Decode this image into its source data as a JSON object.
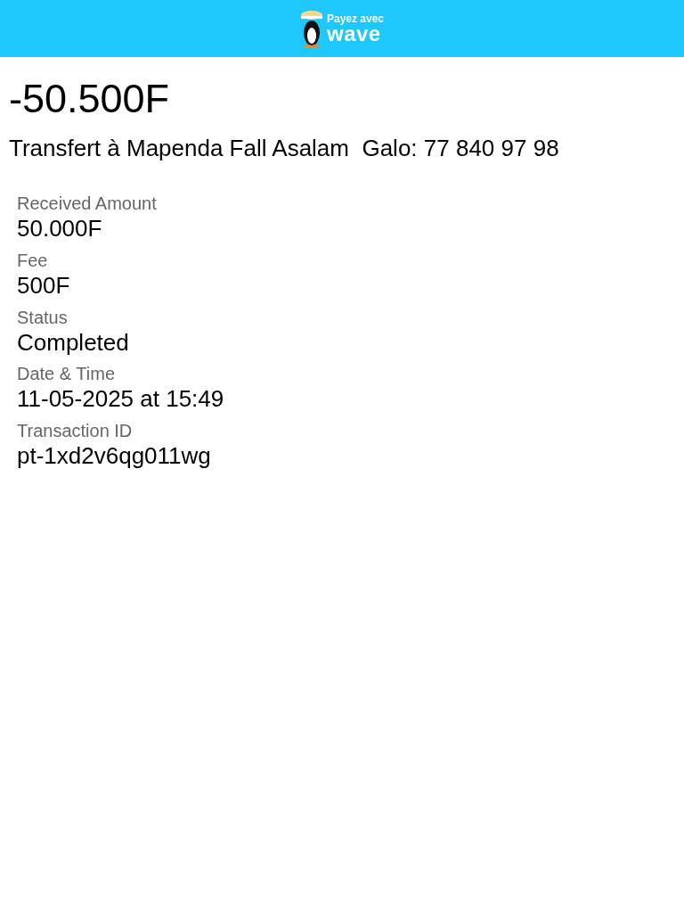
{
  "header": {
    "logo_line1": "Payez avec",
    "logo_line2": "wave"
  },
  "amount": "-50.500F",
  "description": "Transfert à Mapenda Fall Asalam  Galo: 77 840 97 98",
  "details": [
    {
      "label": "Received Amount",
      "value": "50.000F"
    },
    {
      "label": "Fee",
      "value": "500F"
    },
    {
      "label": "Status",
      "value": "Completed"
    },
    {
      "label": "Date & Time",
      "value": "11-05-2025 at 15:49"
    },
    {
      "label": "Transaction ID",
      "value": "pt-1xd2v6qg011wg"
    }
  ]
}
